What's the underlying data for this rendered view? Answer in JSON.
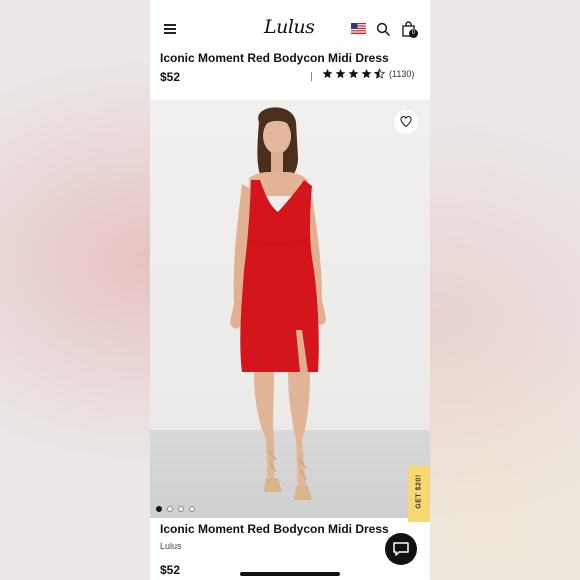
{
  "header": {
    "logo": "Lulus",
    "cart_count": "0",
    "icons": [
      "menu-icon",
      "us-flag-icon",
      "search-icon",
      "shopping-bag-icon"
    ]
  },
  "product": {
    "title": "Iconic Moment Red Bodycon Midi Dress",
    "price": "$52",
    "rating": 4.5,
    "rating_max": 5,
    "review_count": "(1130)",
    "brand": "Lulus"
  },
  "gallery": {
    "image_count": 4,
    "active_index": 0,
    "wishlist_icon": "heart-icon"
  },
  "promo": {
    "label": "GET $20!"
  },
  "chat": {
    "icon": "chat-bubble-icon"
  },
  "colors": {
    "dress": "#d4161c",
    "promo_tab": "#f7d873",
    "text": "#111111"
  }
}
